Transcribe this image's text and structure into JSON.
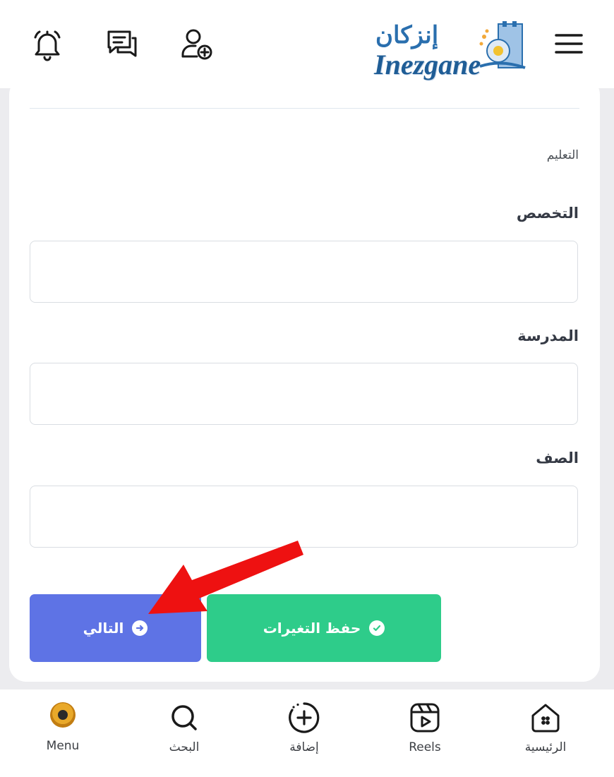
{
  "header": {
    "logo_arabic": "إنزكان",
    "logo_latin": "Inezgane",
    "icons": [
      "notification-bell-icon",
      "messages-icon",
      "add-friend-icon",
      "hamburger-menu-icon"
    ]
  },
  "form": {
    "section_label": "التعليم",
    "fields": [
      {
        "label": "التخصص",
        "value": ""
      },
      {
        "label": "المدرسة",
        "value": ""
      },
      {
        "label": "الصف",
        "value": ""
      }
    ],
    "buttons": {
      "next_label": "التالي",
      "save_label": "حفظ التغيرات"
    }
  },
  "bottom_nav": {
    "items": [
      {
        "label": "Menu",
        "icon": "avatar-icon"
      },
      {
        "label": "البحث",
        "icon": "search-icon"
      },
      {
        "label": "إضافة",
        "icon": "add-circle-icon"
      },
      {
        "label": "Reels",
        "icon": "reels-icon"
      },
      {
        "label": "الرئيسية",
        "icon": "home-icon"
      }
    ]
  },
  "colors": {
    "next_button": "#5e73e5",
    "save_button": "#2ecc8a",
    "annotation_arrow": "#ee1111",
    "page_background": "#ececef"
  }
}
